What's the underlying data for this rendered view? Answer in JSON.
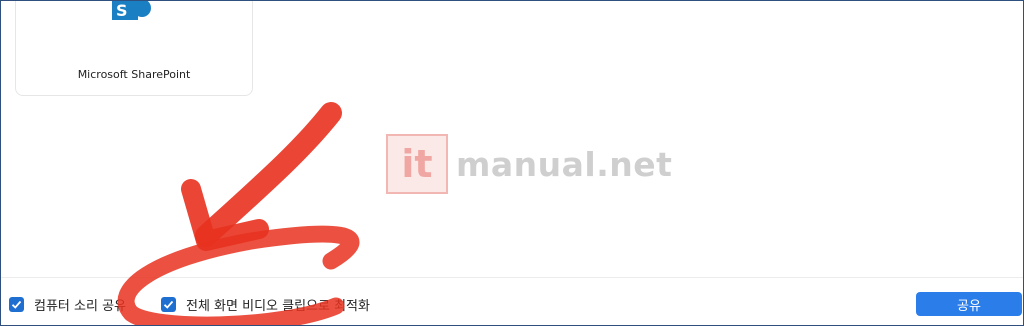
{
  "app_card": {
    "label": "Microsoft SharePoint",
    "icon": "sharepoint-icon"
  },
  "watermark": {
    "box_text": "it",
    "text": "manual.net"
  },
  "options": [
    {
      "label": "컴퓨터 소리 공유",
      "checked": true
    },
    {
      "label": "전체 화면 비디오 클립으로 최적화",
      "checked": true
    }
  ],
  "share_button": {
    "label": "공유"
  },
  "colors": {
    "accent": "#2b7de9",
    "checkbox": "#1f6fd1",
    "annotation": "#e8311f"
  }
}
